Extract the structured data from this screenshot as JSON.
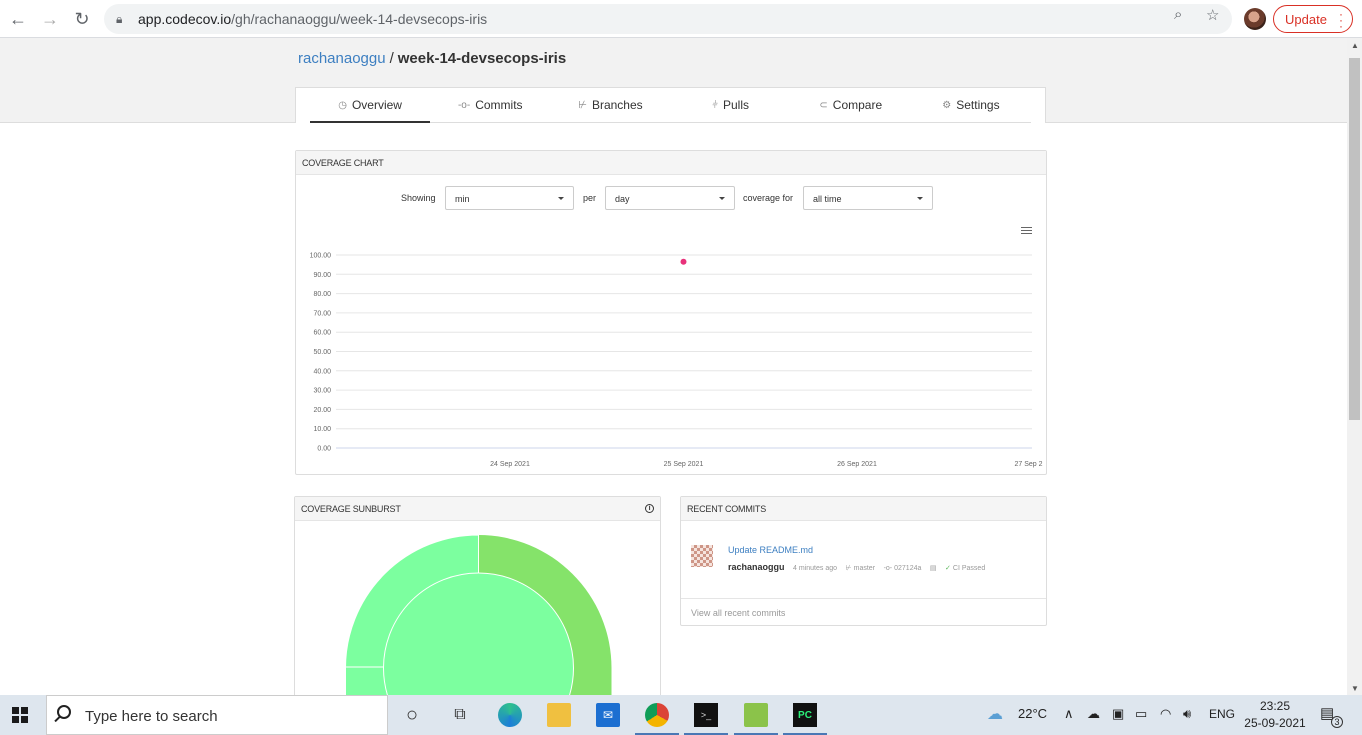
{
  "browser": {
    "url_host": "app.codecov.io",
    "url_path": "/gh/rachanaoggu/week-14-devsecops-iris",
    "update_label": "Update"
  },
  "breadcrumb": {
    "owner": "rachanaoggu",
    "separator": "/",
    "repo": "week-14-devsecops-iris"
  },
  "tabs": [
    {
      "label": "Overview",
      "icon": "dashboard-icon",
      "glyph": "◷"
    },
    {
      "label": "Commits",
      "icon": "commit-icon",
      "glyph": "-o-"
    },
    {
      "label": "Branches",
      "icon": "branch-icon",
      "glyph": "⊬"
    },
    {
      "label": "Pulls",
      "icon": "pull-icon",
      "glyph": "⫩"
    },
    {
      "label": "Compare",
      "icon": "compare-icon",
      "glyph": "⊂"
    },
    {
      "label": "Settings",
      "icon": "gear-icon",
      "glyph": "⚙"
    }
  ],
  "coverage_chart": {
    "header": "COVERAGE CHART",
    "showing_label": "Showing",
    "showing_value": "min",
    "per_label": "per",
    "per_value": "day",
    "coverage_for_label": "coverage for",
    "coverage_for_value": "all time"
  },
  "chart_data": {
    "type": "scatter",
    "x_ticks": [
      "24 Sep 2021",
      "25 Sep 2021",
      "26 Sep 2021",
      "27 Sep 2"
    ],
    "y_ticks": [
      "0.00",
      "10.00",
      "20.00",
      "30.00",
      "40.00",
      "50.00",
      "60.00",
      "70.00",
      "80.00",
      "90.00",
      "100.00"
    ],
    "ylim": [
      0,
      100
    ],
    "x_range_days": [
      23.0,
      27.0
    ],
    "series": [
      {
        "x": [
          "25 Sep 2021"
        ],
        "values": [
          96.5
        ],
        "color": "#e8317a"
      }
    ],
    "grid": true
  },
  "sunburst": {
    "header": "COVERAGE SUNBURST",
    "info_glyph": "i",
    "colors": [
      "#7cff9f",
      "#85e36a"
    ]
  },
  "recent_commits": {
    "header": "RECENT COMMITS",
    "items": [
      {
        "message": "Update README.md",
        "author": "rachanaoggu",
        "time": "4 minutes ago",
        "branch": "master",
        "sha": "027124a",
        "ci": "CI Passed"
      }
    ],
    "view_all": "View all recent commits"
  },
  "taskbar": {
    "search_placeholder": "Type here to search",
    "weather": "22°C",
    "language": "ENG",
    "time": "23:25",
    "date": "25-09-2021",
    "notification_count": "3"
  }
}
